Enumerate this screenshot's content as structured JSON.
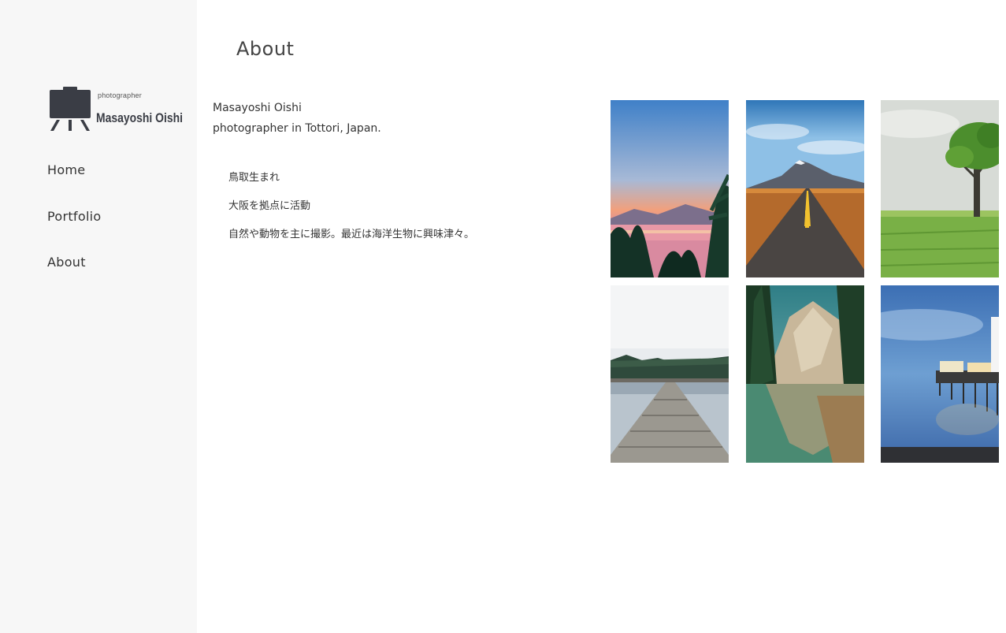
{
  "site": {
    "logo_small": "photographer",
    "logo_name": "Masayoshi Oishi"
  },
  "nav": {
    "items": [
      {
        "label": "Home"
      },
      {
        "label": "Portfolio"
      },
      {
        "label": "About"
      }
    ]
  },
  "main": {
    "title": "About",
    "intro": {
      "name": "Masayoshi Oishi",
      "tagline": "photographer in Tottori, Japan."
    },
    "bio": [
      "鳥取生まれ",
      "大阪を拠点に活動",
      "自然や動物を主に撮影。最近は海洋生物に興味津々。"
    ]
  },
  "gallery": {
    "photos": [
      {
        "subject": "sunset-palms"
      },
      {
        "subject": "desert-road"
      },
      {
        "subject": "lone-tree"
      },
      {
        "subject": "lake-pier"
      },
      {
        "subject": "mountain-lake"
      },
      {
        "subject": "seaside-pier"
      }
    ]
  },
  "colors": {
    "sidebar_bg": "#f7f7f7",
    "text": "#333333",
    "logo": "#3a3d45"
  }
}
